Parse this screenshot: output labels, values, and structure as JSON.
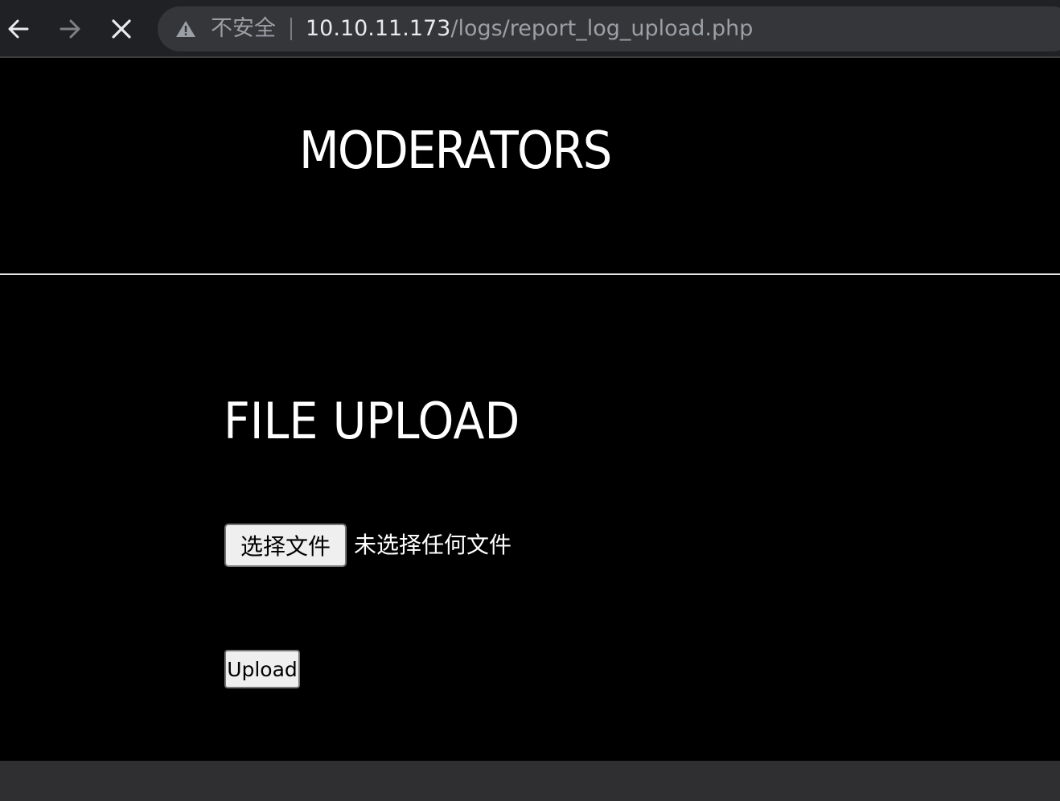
{
  "browser": {
    "security_label": "不安全",
    "url_host": "10.10.11.173",
    "url_path": "/logs/report_log_upload.php",
    "icons": [
      "back-arrow-icon",
      "forward-arrow-icon",
      "close-icon",
      "warning-icon"
    ]
  },
  "page": {
    "title": "MODERATORS",
    "section_heading": "FILE UPLOAD",
    "file_input": {
      "button_label": "选择文件",
      "status_text": "未选择任何文件"
    },
    "upload_button_label": "Upload"
  },
  "colors": {
    "page_background": "#000000",
    "text": "#ffffff",
    "toolbar": "#202124",
    "omnibox": "#35363a"
  }
}
